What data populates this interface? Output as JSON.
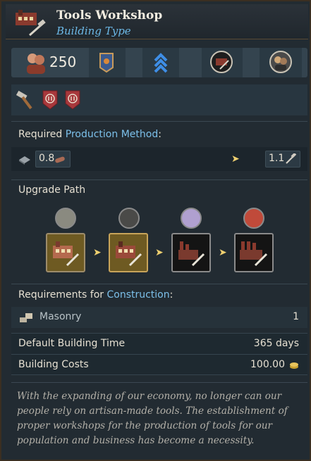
{
  "header": {
    "title": "Tools Workshop",
    "subtitle": "Building Type",
    "icon": "tools-workshop-icon"
  },
  "stats": {
    "population": "250"
  },
  "production": {
    "label_prefix": "Required ",
    "label_highlight": "Production Method",
    "label_suffix": ":",
    "input_value": "0.8",
    "output_value": "1.1"
  },
  "upgrade": {
    "label": "Upgrade Path"
  },
  "construction": {
    "label_prefix": "Requirements for ",
    "label_highlight": "Construction",
    "label_suffix": ":",
    "masonry_label": "Masonry",
    "masonry_value": "1",
    "time_label": "Default Building Time",
    "time_value": "365 days",
    "cost_label": "Building Costs",
    "cost_value": "100.00"
  },
  "description": "With the expanding of our economy, no longer can our people rely on artisan-made tools. The establishment of proper workshops for the production of tools for our population and business has become a necessity.",
  "colors": {
    "accent": "#6cb8e6",
    "gold": "#e8c45c",
    "badge_red": "#a8383c"
  }
}
